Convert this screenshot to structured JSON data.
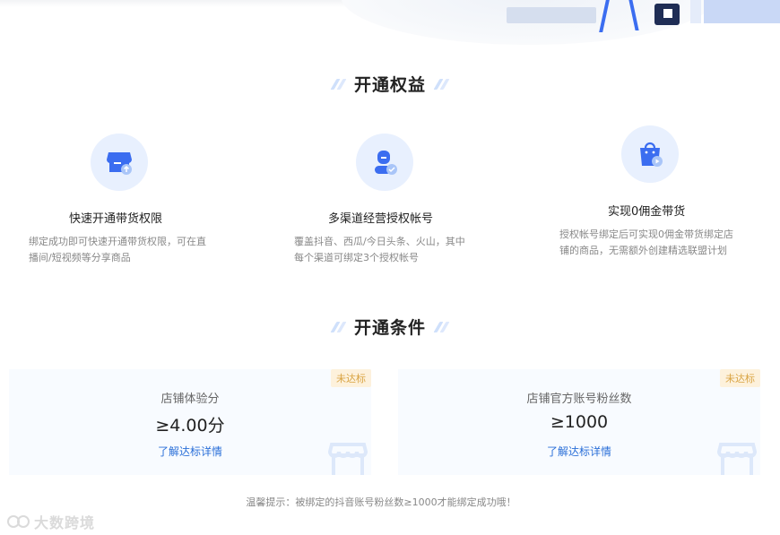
{
  "benefits_section": {
    "title": "开通权益",
    "items": [
      {
        "title": "快速开通带货权限",
        "description": "绑定成功即可快速开通带货权限，可在直播间/短视频等分享商品",
        "icon": "shop-upload-icon"
      },
      {
        "title": "多渠道经营授权帐号",
        "description": "覆盖抖音、西瓜/今日头条、火山，其中每个渠道可绑定3个授权帐号",
        "icon": "user-check-icon"
      },
      {
        "title": "实现0佣金带货",
        "description": "授权帐号绑定后可实现0佣金带货绑定店铺的商品，无需额外创建精选联盟计划",
        "icon": "shopping-bag-icon"
      }
    ]
  },
  "conditions_section": {
    "title": "开通条件",
    "cards": [
      {
        "badge": "未达标",
        "label": "店铺体验分",
        "value": "≥4.00分",
        "link": "了解达标详情"
      },
      {
        "badge": "未达标",
        "label": "店铺官方账号粉丝数",
        "value": "≥1000",
        "link": "了解达标详情"
      }
    ]
  },
  "tip": "温馨提示：被绑定的抖音账号粉丝数≥1000才能绑定成功哦！",
  "watermark": {
    "text": "大数跨境"
  },
  "colors": {
    "accent": "#2a6fd8",
    "icon_blue": "#3b6df0",
    "icon_bg": "#e8f0fe",
    "badge_bg": "#fdf1dc",
    "badge_text": "#d9a443",
    "card_bg": "#f8fbff"
  }
}
